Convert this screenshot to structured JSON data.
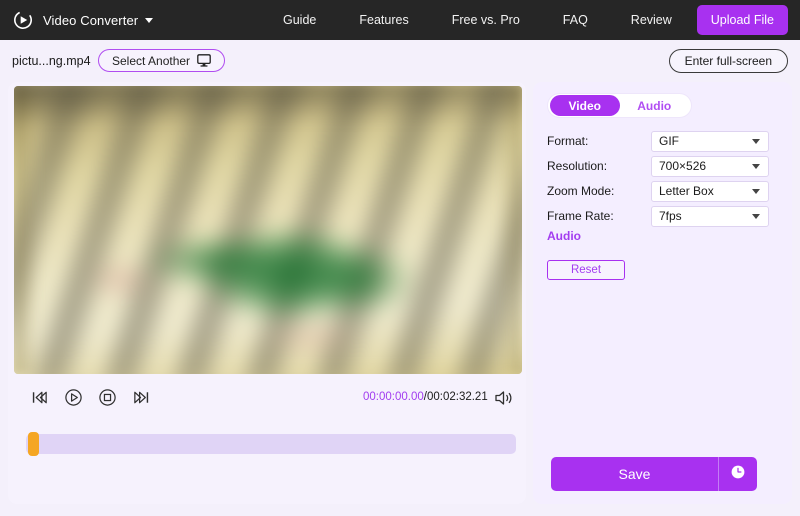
{
  "topbar": {
    "logo_icon": "play-circle-icon",
    "brand_name": "Video Converter",
    "dropdown_icon": "chevron-down-icon",
    "nav_links": [
      {
        "label": "Guide"
      },
      {
        "label": "Features"
      },
      {
        "label": "Free vs. Pro"
      },
      {
        "label": "FAQ"
      },
      {
        "label": "Review"
      }
    ],
    "upload_label": "Upload File",
    "bg_color": "#262626",
    "accent_color": "#a831f0"
  },
  "subheader": {
    "filename": "pictu...ng.mp4",
    "select_another_label": "Select Another",
    "select_another_icon": "monitor-icon",
    "fullscreen_label": "Enter full-screen"
  },
  "player": {
    "controls": [
      {
        "name": "previous-frame-button",
        "icon": "step-backward-icon"
      },
      {
        "name": "play-button",
        "icon": "play-circle-icon"
      },
      {
        "name": "stop-button",
        "icon": "stop-circle-icon"
      },
      {
        "name": "next-frame-button",
        "icon": "step-forward-icon"
      }
    ],
    "current_time": "00:00:00.00",
    "time_separator": "/",
    "total_time": "00:02:32.21",
    "current_time_color": "#a23df0",
    "volume_icon": "speaker-icon",
    "trim_handle_color": "#f5a623",
    "trim_handle_position_pct": 0
  },
  "settings": {
    "tabs": [
      {
        "label": "Video",
        "active": true
      },
      {
        "label": "Audio",
        "active": false
      }
    ],
    "fields": [
      {
        "label": "Format:",
        "value": "GIF"
      },
      {
        "label": "Resolution:",
        "value": "700×526"
      },
      {
        "label": "Zoom Mode:",
        "value": "Letter Box"
      },
      {
        "label": "Frame Rate:",
        "value": "7fps"
      }
    ],
    "audio_heading": "Audio",
    "reset_label": "Reset",
    "save_label": "Save",
    "save_clock_icon": "clock-icon",
    "accent_color": "#a831f0"
  }
}
